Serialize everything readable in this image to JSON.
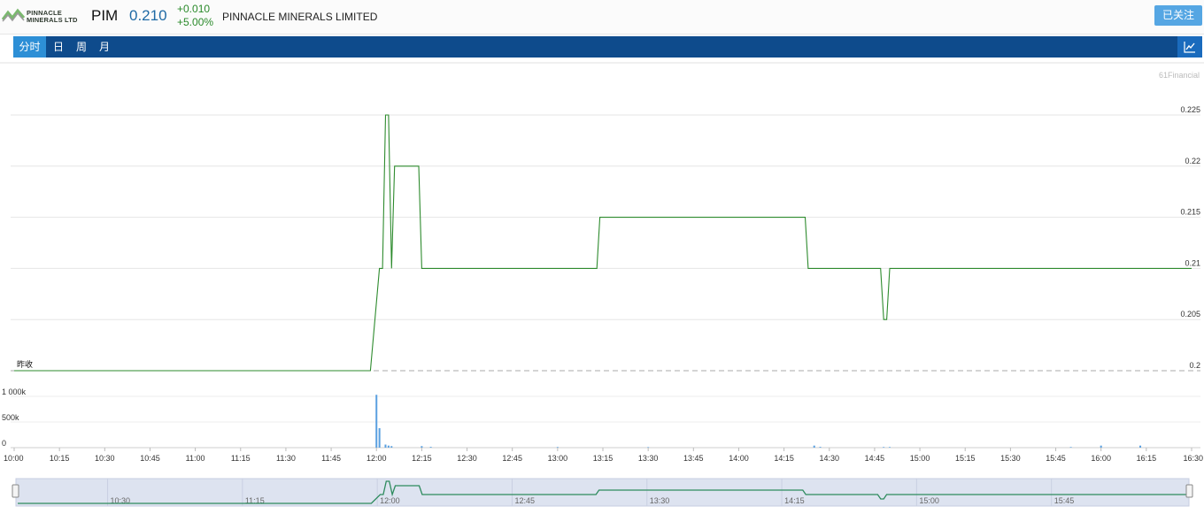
{
  "header": {
    "logo_text_line1": "PINNACLE",
    "logo_text_line2": "MINERALS LTD",
    "symbol": "PIM",
    "price": "0.210",
    "change_abs": "+0.010",
    "change_pct": "+5.00%",
    "company_name": "PINNACLE MINERALS LIMITED",
    "follow_label": "已关注"
  },
  "tabs": [
    {
      "label": "分时",
      "active": true
    },
    {
      "label": "日",
      "active": false
    },
    {
      "label": "周",
      "active": false
    },
    {
      "label": "月",
      "active": false
    }
  ],
  "icons": {
    "chart_toggle": "line-chart-icon"
  },
  "colors": {
    "price_line": "#2e8b2e",
    "volume_bar": "#5aa0e0",
    "accent": "#0e4b8c",
    "active_tab": "#2d8fd6"
  },
  "chart_data": {
    "type": "line",
    "watermark": "61Financial",
    "prev_close_label": "昨收",
    "prev_close": 0.2,
    "price_axis": {
      "ylim": [
        0.2,
        0.225
      ],
      "ticks": [
        0.225,
        0.22,
        0.215,
        0.21,
        0.205,
        0.2
      ],
      "tick_labels": [
        "0.225",
        "0.22",
        "0.215",
        "0.21",
        "0.205",
        "0.2"
      ]
    },
    "volume_axis": {
      "ylim": [
        0,
        1000000
      ],
      "ticks": [
        1000000,
        500000,
        0
      ],
      "tick_labels": [
        "1 000k",
        "500k",
        "0"
      ]
    },
    "x_axis": {
      "range": [
        "10:00",
        "16:30"
      ],
      "ticks": [
        "10:00",
        "10:15",
        "10:30",
        "10:45",
        "11:00",
        "11:15",
        "11:30",
        "11:45",
        "12:00",
        "12:15",
        "12:30",
        "12:45",
        "13:00",
        "13:15",
        "13:30",
        "13:45",
        "14:00",
        "14:15",
        "14:30",
        "14:45",
        "15:00",
        "15:15",
        "15:30",
        "15:45",
        "16:00",
        "16:15",
        "16:30"
      ]
    },
    "series": [
      {
        "values": [
          [
            "10:00",
            0.2
          ],
          [
            "11:58",
            0.2
          ],
          [
            "12:01",
            0.21
          ],
          [
            "12:02",
            0.21
          ],
          [
            "12:03",
            0.225
          ],
          [
            "12:04",
            0.225
          ],
          [
            "12:05",
            0.21
          ],
          [
            "12:06",
            0.22
          ],
          [
            "12:14",
            0.22
          ],
          [
            "12:15",
            0.21
          ],
          [
            "13:13",
            0.21
          ],
          [
            "13:14",
            0.215
          ],
          [
            "14:22",
            0.215
          ],
          [
            "14:23",
            0.21
          ],
          [
            "14:47",
            0.21
          ],
          [
            "14:48",
            0.205
          ],
          [
            "14:49",
            0.205
          ],
          [
            "14:50",
            0.21
          ],
          [
            "16:30",
            0.21
          ]
        ]
      }
    ],
    "volume": [
      [
        "12:00",
        1030000
      ],
      [
        "12:01",
        380000
      ],
      [
        "12:03",
        60000
      ],
      [
        "12:04",
        40000
      ],
      [
        "12:05",
        30000
      ],
      [
        "12:15",
        30000
      ],
      [
        "12:18",
        15000
      ],
      [
        "13:00",
        12000
      ],
      [
        "13:30",
        10000
      ],
      [
        "14:25",
        40000
      ],
      [
        "14:27",
        15000
      ],
      [
        "14:48",
        12000
      ],
      [
        "14:50",
        12000
      ],
      [
        "15:50",
        12000
      ],
      [
        "16:00",
        40000
      ],
      [
        "16:13",
        40000
      ]
    ],
    "navigator": {
      "tick_labels": [
        "10:30",
        "11:15",
        "12:00",
        "12:45",
        "13:30",
        "14:15",
        "15:00",
        "15:45"
      ]
    }
  }
}
